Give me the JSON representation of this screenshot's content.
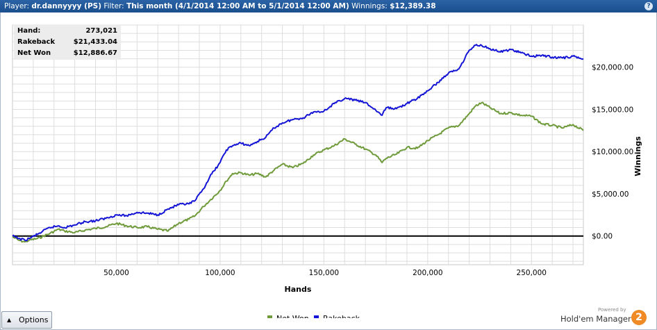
{
  "titlebar": {
    "player_label": "Player:",
    "player": "dr.dannyyyy (PS)",
    "filter_label": "Filter:",
    "filter": "This month (4/1/2014 12:00 AM to 5/1/2014 12:00 AM)",
    "winnings_label": "Winnings:",
    "winnings": "$12,389.38",
    "help_icon": "question-icon"
  },
  "stats": [
    {
      "label": "Hand:",
      "value": "273,021"
    },
    {
      "label": "Rakeback",
      "value": "$21,433.04"
    },
    {
      "label": "Net Won",
      "value": "$12,886.67"
    }
  ],
  "options": {
    "label": "Options",
    "icon": "triangle-up-icon"
  },
  "brand": {
    "powered_by": "Powered by",
    "name": "Hold'em Manager",
    "badge": "2"
  },
  "chart_data": {
    "type": "line",
    "xlabel": "Hands",
    "ylabel": "Winnings",
    "xlim": [
      0,
      275000
    ],
    "ylim": [
      -3400,
      25000
    ],
    "x_ticks": [
      50000,
      100000,
      150000,
      200000,
      250000
    ],
    "x_tick_labels": [
      "50,000",
      "100,000",
      "150,000",
      "200,000",
      "250,000"
    ],
    "y_ticks": [
      0,
      5000,
      10000,
      15000,
      20000
    ],
    "y_tick_labels": [
      "$0.00",
      "$5,000.00",
      "$10,000.00",
      "$15,000.00",
      "$20,000.00"
    ],
    "grid": true,
    "legend": "bottom-center",
    "colors": {
      "Net Won": "#6f9a3a",
      "Rakeback": "#1414d6",
      "zero_line": "#000000",
      "grid": "#dddddd"
    },
    "series": [
      {
        "name": "Net Won",
        "x": [
          0,
          3000,
          6000,
          8000,
          12000,
          18000,
          22000,
          25000,
          30000,
          35000,
          40000,
          45000,
          50000,
          55000,
          60000,
          65000,
          70000,
          75000,
          80000,
          85000,
          88000,
          92000,
          95000,
          100000,
          103000,
          106000,
          110000,
          114000,
          118000,
          122000,
          126000,
          130000,
          135000,
          140000,
          145000,
          150000,
          155000,
          160000,
          165000,
          170000,
          175000,
          178000,
          180000,
          185000,
          190000,
          195000,
          200000,
          205000,
          210000,
          215000,
          220000,
          223000,
          226000,
          230000,
          235000,
          240000,
          245000,
          250000,
          255000,
          260000,
          265000,
          270000,
          275000
        ],
        "y": [
          -100,
          -500,
          -700,
          -500,
          -300,
          300,
          800,
          600,
          400,
          700,
          900,
          1100,
          1500,
          1200,
          1000,
          1100,
          800,
          600,
          1500,
          2000,
          2400,
          3500,
          4200,
          5400,
          6500,
          7400,
          7500,
          7200,
          7400,
          7000,
          7800,
          8500,
          8100,
          8600,
          9600,
          10200,
          10700,
          11500,
          10900,
          10300,
          9600,
          8700,
          9200,
          9700,
          10500,
          10400,
          11300,
          12000,
          12800,
          13100,
          14500,
          15400,
          15800,
          15200,
          14500,
          14600,
          14300,
          14200,
          13300,
          13100,
          12800,
          13200,
          12500
        ]
      },
      {
        "name": "Rakeback",
        "x": [
          0,
          3000,
          6000,
          8000,
          12000,
          18000,
          22000,
          25000,
          30000,
          35000,
          40000,
          45000,
          50000,
          55000,
          60000,
          65000,
          70000,
          75000,
          80000,
          85000,
          88000,
          92000,
          95000,
          100000,
          103000,
          106000,
          110000,
          114000,
          118000,
          122000,
          126000,
          130000,
          135000,
          140000,
          145000,
          150000,
          155000,
          160000,
          165000,
          170000,
          175000,
          178000,
          180000,
          185000,
          190000,
          195000,
          200000,
          205000,
          210000,
          215000,
          220000,
          223000,
          226000,
          230000,
          235000,
          240000,
          245000,
          250000,
          255000,
          260000,
          265000,
          270000,
          275000
        ],
        "y": [
          0,
          -300,
          -500,
          -300,
          200,
          1000,
          1200,
          1000,
          1300,
          1700,
          1800,
          2100,
          2500,
          2400,
          2800,
          2700,
          2500,
          3200,
          3700,
          3800,
          4200,
          5600,
          7000,
          8700,
          10200,
          10700,
          11000,
          10700,
          11200,
          11700,
          12800,
          13400,
          13800,
          14000,
          14700,
          14800,
          15700,
          16300,
          16100,
          15800,
          14900,
          14300,
          15200,
          15100,
          15700,
          16300,
          17200,
          18200,
          19300,
          19800,
          22000,
          22600,
          22600,
          22200,
          21800,
          22100,
          21700,
          21300,
          21400,
          21200,
          21100,
          21300,
          21000
        ]
      }
    ]
  }
}
